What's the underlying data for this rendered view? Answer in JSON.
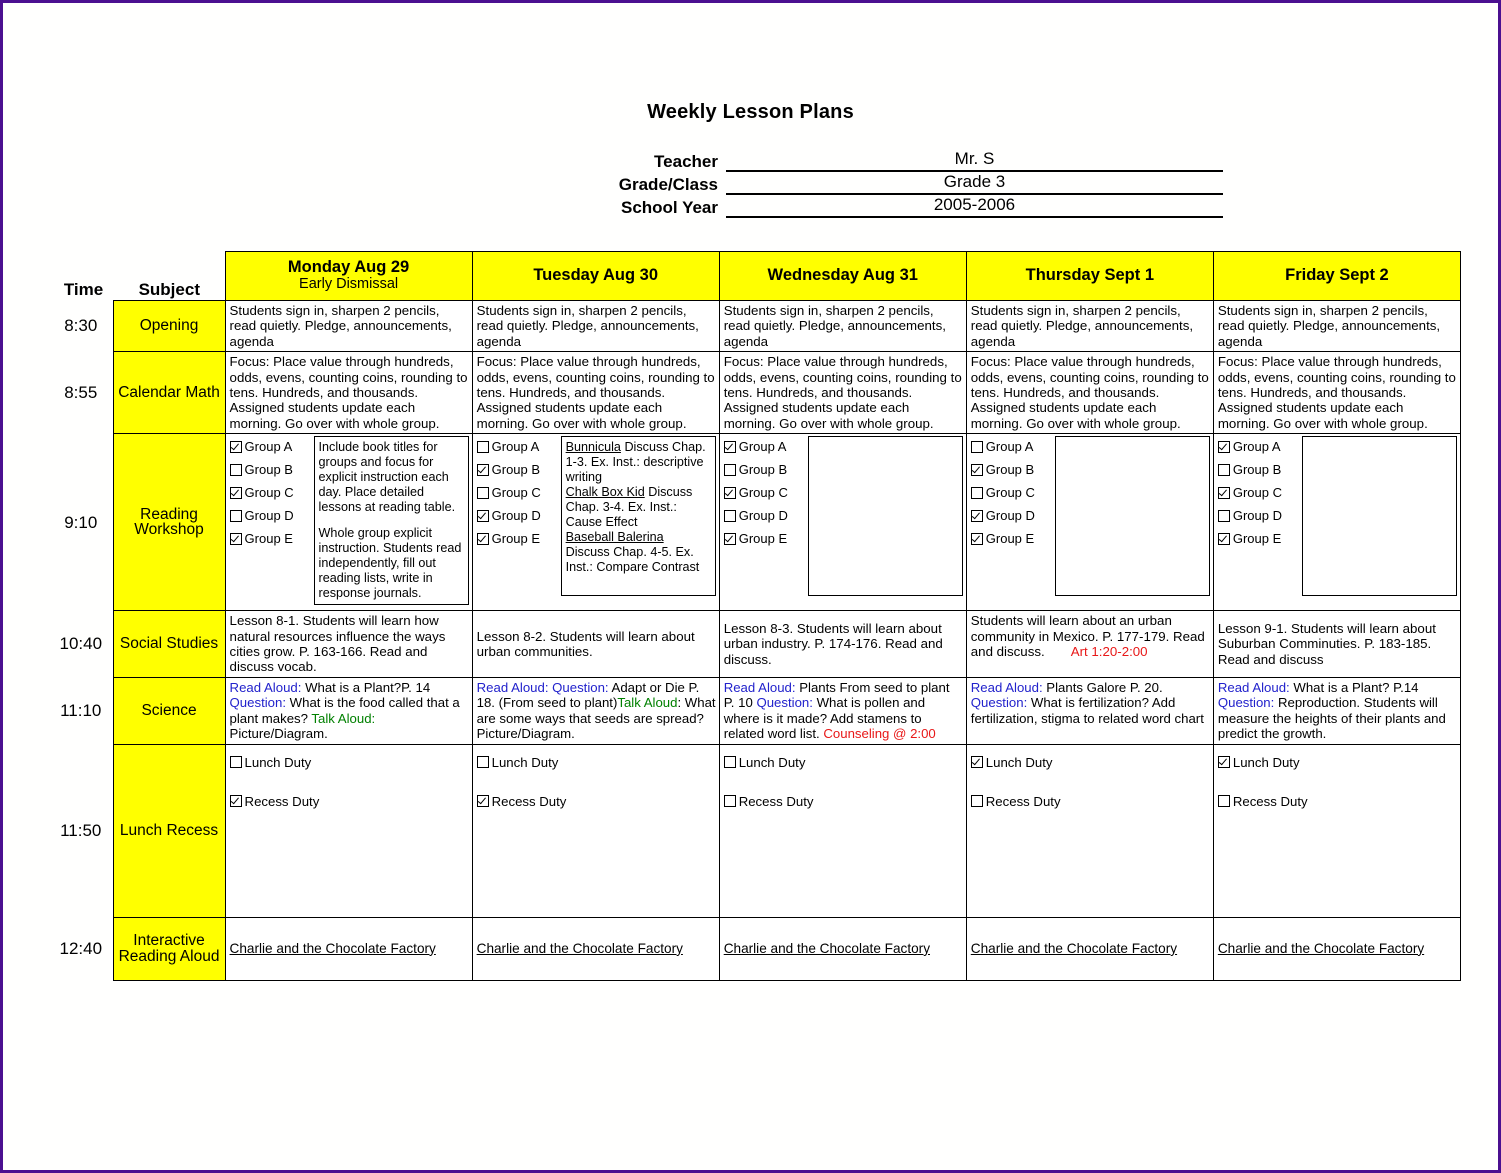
{
  "document": {
    "title": "Weekly Lesson Plans"
  },
  "meta": {
    "rows": [
      {
        "label": "Teacher",
        "value": "Mr. S"
      },
      {
        "label": "Grade/Class",
        "value": "Grade 3"
      },
      {
        "label": "School Year",
        "value": "2005-2006"
      }
    ]
  },
  "table": {
    "time_header": "Time",
    "subject_header": "Subject",
    "days": [
      {
        "name": "Monday Aug 29",
        "note": "Early Dismissal"
      },
      {
        "name": "Tuesday Aug 30",
        "note": ""
      },
      {
        "name": "Wednesday Aug 31",
        "note": ""
      },
      {
        "name": "Thursday Sept 1",
        "note": ""
      },
      {
        "name": "Friday Sept 2",
        "note": ""
      }
    ],
    "rows": [
      {
        "time": "8:30",
        "subject": "Opening",
        "cells": [
          "Students sign in, sharpen 2 pencils, read quietly. Pledge, announcements, agenda",
          "Students sign in, sharpen 2 pencils, read quietly. Pledge, announcements, agenda",
          "Students sign in, sharpen 2 pencils, read quietly. Pledge, announcements, agenda",
          "Students sign in, sharpen 2 pencils, read quietly. Pledge, announcements, agenda",
          "Students sign in, sharpen 2 pencils, read quietly. Pledge, announcements, agenda"
        ]
      },
      {
        "time": "8:55",
        "subject": "Calendar Math",
        "cells": [
          "Focus: Place value through hundreds, odds, evens, counting coins, rounding to tens. Hundreds, and thousands. Assigned students update each morning. Go over with whole group.",
          "Focus: Place value through hundreds, odds, evens, counting coins, rounding to tens. Hundreds, and thousands. Assigned students update each morning. Go over with whole group.",
          "Focus: Place value through hundreds, odds, evens, counting coins, rounding to tens. Hundreds, and thousands. Assigned students update each morning. Go over with whole group.",
          "Focus: Place value through hundreds, odds, evens, counting coins, rounding to tens. Hundreds, and thousands. Assigned students update each morning. Go over with whole group.",
          "Focus: Place value through hundreds, odds, evens, counting coins, rounding to tens. Hundreds, and thousands. Assigned students update each morning. Go over with whole group."
        ]
      },
      {
        "time": "10:40",
        "subject": "Social Studies",
        "cells": [
          "Lesson 8-1. Students will learn how natural resources influence the ways cities grow. P. 163-166. Read and discuss vocab.",
          "Lesson 8-2. Students will learn about urban communities.",
          "Lesson 8-3. Students will learn about urban industry. P. 174-176. Read and discuss.",
          "Students will learn about an urban community in Mexico. P. 177-179. Read and discuss.",
          "Lesson 9-1. Students will learn about Suburban Comminuties. P. 183-185. Read and discuss"
        ],
        "annotation_thursday": "Art 1:20-2:00"
      }
    ],
    "reading_workshop": {
      "time": "9:10",
      "subject": "Reading Workshop",
      "group_labels": [
        "Group A",
        "Group B",
        "Group C",
        "Group D",
        "Group E"
      ],
      "days": [
        {
          "checks": [
            true,
            false,
            true,
            false,
            true
          ],
          "note_paragraphs": [
            "Include book titles for groups and focus for explicit instruction each day. Place detailed lessons at reading table.",
            "Whole group explicit instruction. Students read independently, fill out reading lists, write in response journals."
          ],
          "books": []
        },
        {
          "checks": [
            false,
            true,
            false,
            true,
            true
          ],
          "note_paragraphs": [],
          "books": [
            {
              "title": "Bunnicula",
              "text": " Discuss Chap. 1-3. Ex. Inst.: descriptive writing"
            },
            {
              "title": "Chalk Box Kid",
              "text": " Discuss Chap. 3-4. Ex. Inst.: Cause Effect"
            },
            {
              "title": "Baseball Balerina",
              "text": " Discuss Chap. 4-5. Ex. Inst.: Compare Contrast"
            }
          ]
        },
        {
          "checks": [
            true,
            false,
            true,
            false,
            true
          ],
          "note_paragraphs": [],
          "books": []
        },
        {
          "checks": [
            false,
            true,
            false,
            true,
            true
          ],
          "note_paragraphs": [],
          "books": []
        },
        {
          "checks": [
            true,
            false,
            true,
            false,
            true
          ],
          "note_paragraphs": [],
          "books": []
        }
      ]
    },
    "science": {
      "time": "11:10",
      "subject": "Science",
      "days": [
        {
          "parts": [
            {
              "text": "Read Aloud:",
              "color": "blue"
            },
            {
              "text": " What is a Plant?P. 14 ",
              "color": "black"
            },
            {
              "text": "Question:",
              "color": "blue"
            },
            {
              "text": " What is the food called that a plant makes? ",
              "color": "black"
            },
            {
              "text": "Talk Aloud:",
              "color": "green"
            },
            {
              "text": " Picture/Diagram.",
              "color": "black"
            }
          ]
        },
        {
          "parts": [
            {
              "text": "Read Aloud: Question:",
              "color": "blue"
            },
            {
              "text": " Adapt or Die P. 18. (From seed to plant)",
              "color": "black"
            },
            {
              "text": "Talk Aloud",
              "color": "green"
            },
            {
              "text": ": What are some ways that seeds are spread? Picture/Diagram.",
              "color": "black"
            }
          ]
        },
        {
          "parts": [
            {
              "text": "Read Aloud:",
              "color": "blue"
            },
            {
              "text": " Plants From seed to plant P. 10 ",
              "color": "black"
            },
            {
              "text": "Question:",
              "color": "blue"
            },
            {
              "text": " What is pollen and where is it made? Add stamens to related word list. ",
              "color": "black"
            },
            {
              "text": "Counseling @ 2:00",
              "color": "red"
            }
          ]
        },
        {
          "parts": [
            {
              "text": "Read Aloud:",
              "color": "blue"
            },
            {
              "text": " Plants Galore P. 20. ",
              "color": "black"
            },
            {
              "text": "Question:",
              "color": "blue"
            },
            {
              "text": " What is fertilization? Add fertilization, stigma to related word chart",
              "color": "black"
            }
          ]
        },
        {
          "parts": [
            {
              "text": "Read Aloud:",
              "color": "blue"
            },
            {
              "text": " What is a Plant? P.14 ",
              "color": "black"
            },
            {
              "text": "Question:",
              "color": "blue"
            },
            {
              "text": " Reproduction.   Students will measure the heights of their plants and predict the growth.",
              "color": "black"
            }
          ]
        }
      ]
    },
    "lunch_recess": {
      "time": "11:50",
      "subject": "Lunch Recess",
      "duty_labels": [
        "Lunch Duty",
        "Recess Duty"
      ],
      "days": [
        {
          "lunch": false,
          "recess": true
        },
        {
          "lunch": false,
          "recess": true
        },
        {
          "lunch": false,
          "recess": false
        },
        {
          "lunch": true,
          "recess": false
        },
        {
          "lunch": true,
          "recess": false
        }
      ]
    },
    "interactive_reading": {
      "time": "12:40",
      "subject": "Interactive Reading Aloud",
      "cells": [
        "Charlie and the Chocolate Factory ",
        "Charlie and the Chocolate Factory",
        "Charlie and the Chocolate Factory",
        "Charlie and the Chocolate Factory",
        "Charlie and the Chocolate Factory"
      ]
    }
  },
  "colors": {
    "header_highlight": "#ffff00",
    "blue_text": "#2222cc",
    "green_text": "#008000",
    "red_text": "#e81818",
    "page_border": "#4B1090"
  }
}
